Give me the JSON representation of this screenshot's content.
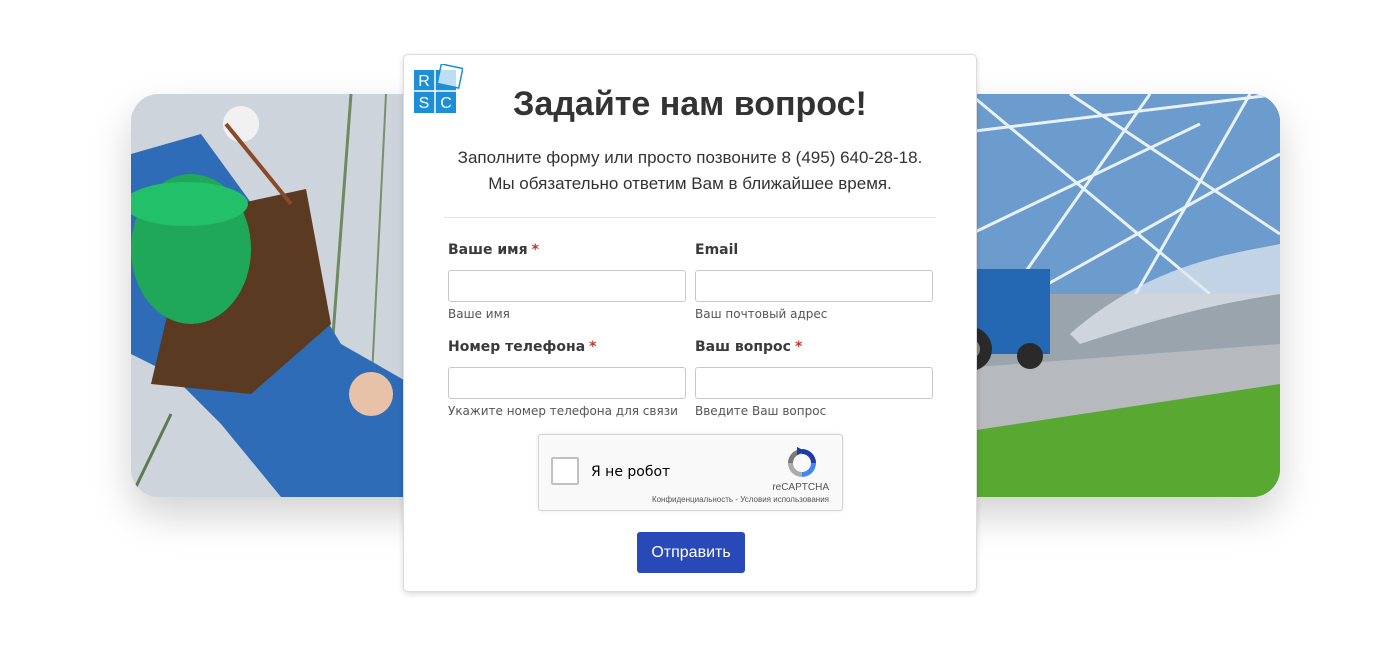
{
  "logo": {
    "letters": [
      "R",
      "S",
      "C"
    ],
    "color": "#1e8fd6"
  },
  "form": {
    "title": "Задайте нам вопрос!",
    "subtitle_line1": "Заполните форму или просто позвоните 8 (495) 640-28-18.",
    "subtitle_line2": "Мы обязательно ответим Вам в ближайшее время.",
    "required_marker": "*",
    "fields": {
      "name": {
        "label": "Ваше имя",
        "required": true,
        "value": "",
        "hint": "Ваше имя"
      },
      "email": {
        "label": "Email",
        "required": false,
        "value": "",
        "hint": "Ваш почтовый адрес"
      },
      "phone": {
        "label": "Номер телефона",
        "required": true,
        "value": "",
        "hint": "Укажите номер телефона для связи"
      },
      "question": {
        "label": "Ваш вопрос",
        "required": true,
        "value": "",
        "hint": "Введите Ваш вопрос"
      }
    },
    "captcha": {
      "checkbox_label": "Я не робот",
      "brand": "reCAPTCHA",
      "links": "Конфиденциальность - Условия использования"
    },
    "submit_label": "Отправить"
  },
  "colors": {
    "accent": "#2a49b8",
    "required": "#c0392b"
  },
  "icons": {
    "recaptcha": "recaptcha-icon",
    "logo": "rsc-logo"
  }
}
